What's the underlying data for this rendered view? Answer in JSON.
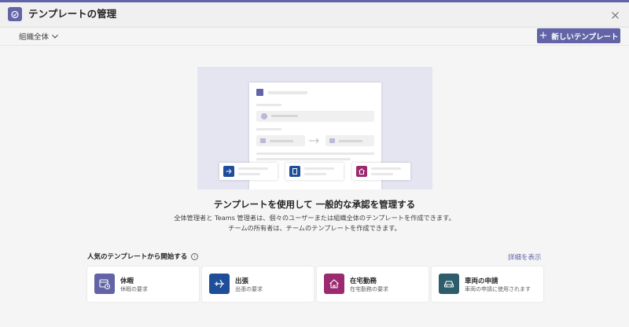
{
  "window": {
    "title": "テンプレートの管理"
  },
  "toolbar": {
    "scope_label": "組織全体",
    "new_template_label": "新しいテンプレート"
  },
  "main": {
    "headline": "テンプレートを使用して 一般的な承認を管理する",
    "description_line1": "全体管理者と Teams 管理者は、個々のユーザーまたは組織全体のテンプレートを作成できます。",
    "description_line2": "チームの所有者は、チームのテンプレートを作成できます。"
  },
  "popular": {
    "title": "人気のテンプレートから開始する",
    "more_label": "詳細を表示",
    "cards": [
      {
        "title": "休暇",
        "subtitle": "休暇の要求",
        "icon": "calendar-clock-icon",
        "color": "#6264a7"
      },
      {
        "title": "出張",
        "subtitle": "出張の要求",
        "icon": "airplane-icon",
        "color": "#1e4e9a"
      },
      {
        "title": "在宅勤務",
        "subtitle": "在宅勤務の要求",
        "icon": "home-icon",
        "color": "#9b2a6f"
      },
      {
        "title": "車両の申請",
        "subtitle": "車両の申請に使用されます",
        "icon": "car-icon",
        "color": "#2d5c6a"
      }
    ]
  },
  "colors": {
    "accent": "#6264a7",
    "hero_background": "#e4e5f1"
  }
}
